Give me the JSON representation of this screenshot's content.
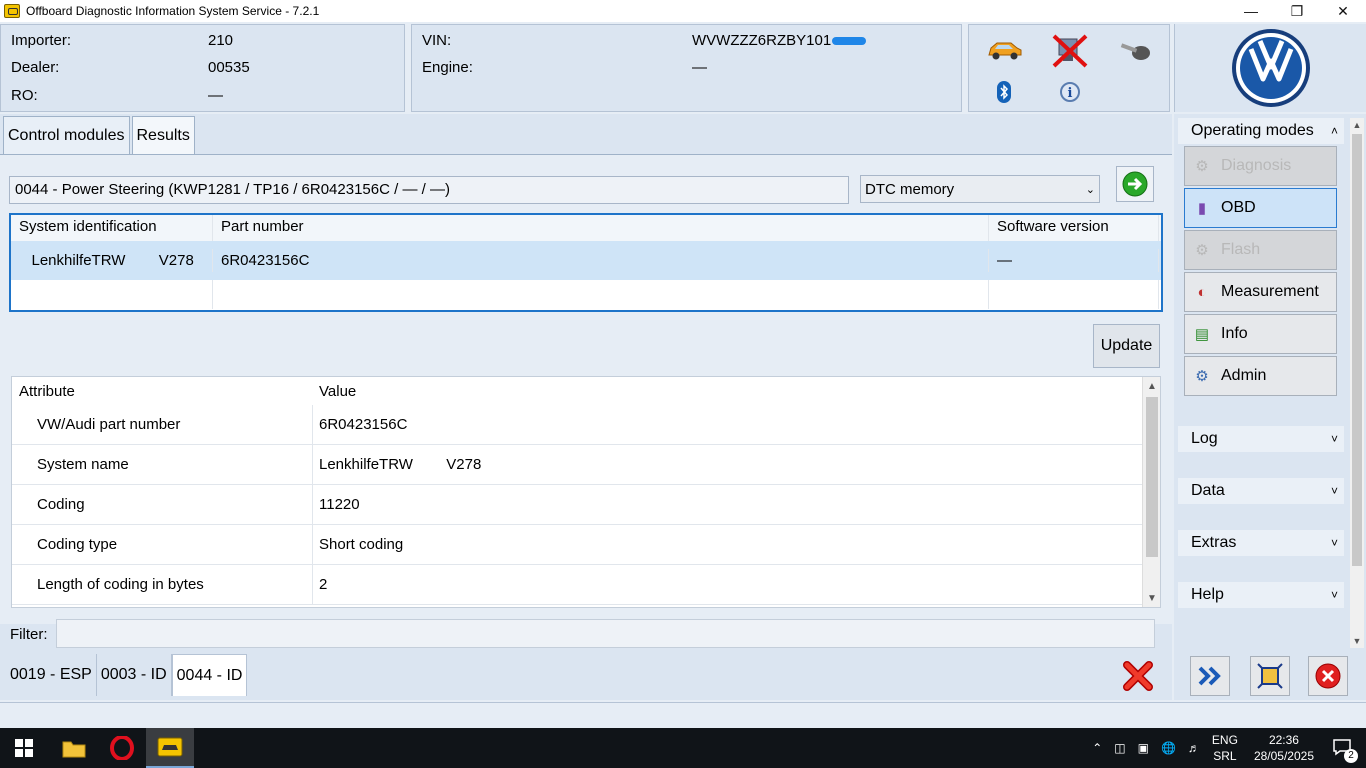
{
  "window": {
    "title": "Offboard Diagnostic Information System Service - 7.2.1"
  },
  "header": {
    "importer_label": "Importer:",
    "importer_value": "210",
    "dealer_label": "Dealer:",
    "dealer_value": "00535",
    "ro_label": "RO:",
    "ro_value": "—",
    "vin_label": "VIN:",
    "vin_value": "WVWZZZ6RZBY101",
    "engine_label": "Engine:",
    "engine_value": "—"
  },
  "tabs": [
    "Control modules",
    "Results"
  ],
  "ecu": {
    "field": "0044 - Power Steering  (KWP1281 / TP16 / 6R0423156C / — / —)",
    "select": "DTC memory"
  },
  "id_table": {
    "headers": [
      "System identification",
      "Part number",
      "Software version"
    ],
    "row": [
      "   LenkhilfeTRW        V278",
      "6R0423156C",
      "—"
    ]
  },
  "update_label": "Update",
  "attr_table": {
    "headers": [
      "Attribute",
      "Value"
    ],
    "rows": [
      [
        "VW/Audi part number",
        "6R0423156C"
      ],
      [
        "System name",
        "LenkhilfeTRW        V278"
      ],
      [
        "Coding",
        "11220"
      ],
      [
        "Coding type",
        "Short coding"
      ],
      [
        "Length of coding in bytes",
        "2"
      ]
    ]
  },
  "filter_label": "Filter:",
  "bottom_tabs": [
    "0019 - ESP",
    "0003 - ID",
    "0044 - ID"
  ],
  "right_panel": {
    "operating_modes": "Operating modes",
    "modes": [
      "Diagnosis",
      "OBD",
      "Flash",
      "Measurement",
      "Info",
      "Admin"
    ],
    "sections": [
      "Log",
      "Data",
      "Extras",
      "Help"
    ]
  },
  "taskbar": {
    "lang1": "ENG",
    "lang2": "SRL",
    "time": "22:36",
    "date": "28/05/2025",
    "notifications": "2"
  },
  "colors": {
    "accent": "#1e74c9",
    "panel": "#dbe5f1",
    "selected_row": "#cfe4f7"
  }
}
